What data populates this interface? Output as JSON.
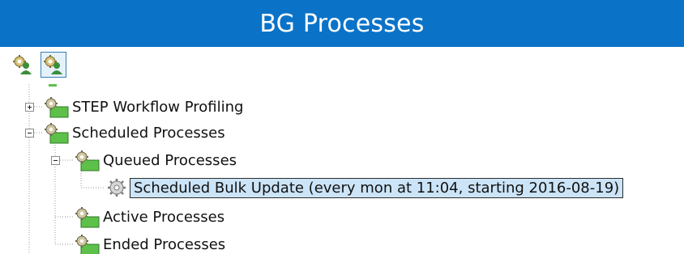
{
  "panel": {
    "title": "BG Processes"
  },
  "toolbar": {
    "buttons": [
      {
        "icon": "process-user-icon",
        "active": false
      },
      {
        "icon": "process-user-icon",
        "active": true
      }
    ]
  },
  "tree": {
    "nodes": [
      {
        "label": "STEP Workflow Profiling",
        "icon": "folder-gear-icon",
        "expander": "plus"
      },
      {
        "label": "Scheduled Processes",
        "icon": "folder-gear-icon",
        "expander": "minus"
      },
      {
        "label": "Queued Processes",
        "icon": "folder-gear-icon",
        "expander": "minus"
      },
      {
        "label": "Scheduled Bulk Update (every mon at 11:04, starting 2016-08-19)",
        "icon": "gear-icon",
        "selected": true
      },
      {
        "label": "Active Processes",
        "icon": "folder-gear-icon"
      },
      {
        "label": "Ended Processes",
        "icon": "folder-gear-icon"
      }
    ]
  },
  "colors": {
    "title_bar": "#0a73c8",
    "selection": "#cce4f7",
    "folder_green": "#5dc04a"
  }
}
